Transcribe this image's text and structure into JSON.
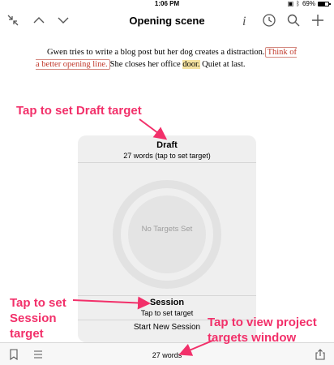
{
  "status_bar": {
    "time": "1:06 PM",
    "battery": "69%",
    "battery_level": 0.69
  },
  "nav": {
    "title": "Opening scene",
    "icons": [
      "collapse-icon",
      "chevron-up-icon",
      "chevron-down-icon",
      "info-icon",
      "clock-icon",
      "search-icon",
      "plus-icon"
    ]
  },
  "document": {
    "text_1": "Gwen tries to write a blog post but her dog creates a distraction.",
    "note_1": "Think of a better opening line.",
    "text_2": "She closes her office ",
    "highlight": "door.",
    "text_3": " Quiet at last."
  },
  "popover": {
    "draft_title": "Draft",
    "draft_subtitle": "27 words (tap to set target)",
    "ring_label": "No Targets Set",
    "session_title": "Session",
    "session_subtitle": "Tap to set target",
    "new_session": "Start New Session"
  },
  "toolbar": {
    "word_count": "27 words",
    "icons": [
      "bookmark-icon",
      "list-icon",
      "share-icon"
    ]
  },
  "annotations": {
    "draft": "Tap to set Draft target",
    "session_1": "Tap to set",
    "session_2": "Session",
    "session_3": "target",
    "project_1": "Tap to view project",
    "project_2": "targets window",
    "color": "#f2306a"
  }
}
